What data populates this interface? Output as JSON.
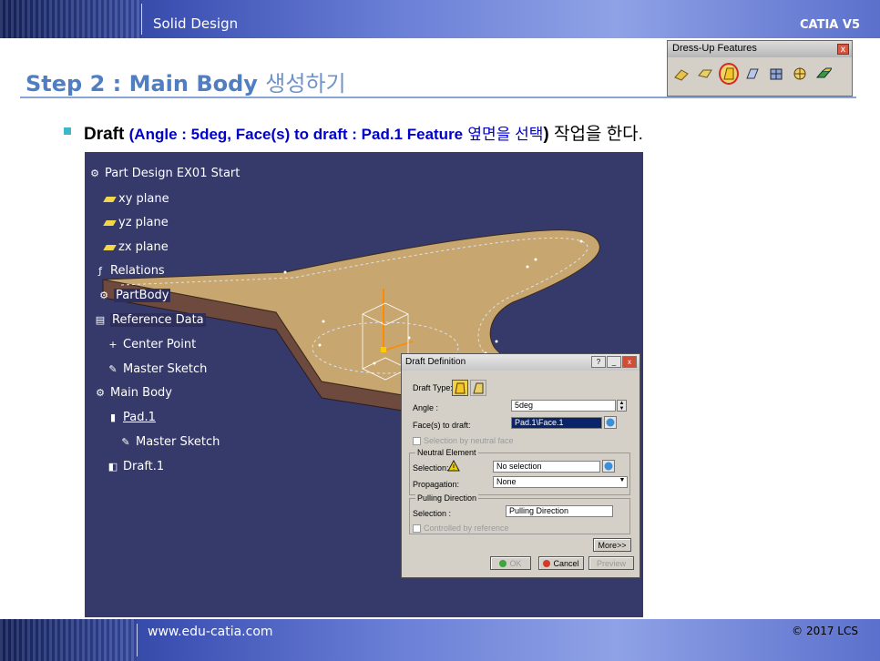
{
  "header": {
    "title": "Solid Design",
    "brand": "CATIA V5"
  },
  "step": {
    "title_en": "Step 2 : Main Body",
    "title_kr": "생성하기"
  },
  "toolbar": {
    "title": "Dress-Up Features",
    "close": "x",
    "tools": [
      {
        "icon": "fillet-icon"
      },
      {
        "icon": "chamfer-icon"
      },
      {
        "icon": "draft-icon",
        "active": true
      },
      {
        "icon": "shell-icon"
      },
      {
        "icon": "thickness-icon"
      },
      {
        "icon": "thread-icon"
      },
      {
        "icon": "remove-face-icon"
      }
    ]
  },
  "instruction": {
    "bold": "Draft",
    "open": "(",
    "params": "Angle : 5deg, Face(s) to draft : Pad.1 Feature",
    "params_kr": "옆면을 선택",
    "close": ")",
    "tail": "작업을 한다."
  },
  "tree": {
    "items": [
      {
        "label": "Part Design EX01 Start"
      },
      {
        "label": "xy plane"
      },
      {
        "label": "yz plane"
      },
      {
        "label": "zx plane"
      },
      {
        "label": "Relations"
      },
      {
        "label": "PartBody"
      },
      {
        "label": "Reference Data"
      },
      {
        "label": "Center Point"
      },
      {
        "label": "Master Sketch"
      },
      {
        "label": "Main Body"
      },
      {
        "label": "Pad.1"
      },
      {
        "label": "Master Sketch"
      },
      {
        "label": "Draft.1"
      }
    ]
  },
  "dialog": {
    "title": "Draft Definition",
    "title_buttons": {
      "help": "?",
      "min": "_",
      "close": "x"
    },
    "draft_type_label": "Draft Type:",
    "angle_label": "Angle :",
    "angle_value": "5deg",
    "faces_label": "Face(s) to draft:",
    "faces_value": "Pad.1\\Face.1",
    "selection_neutral_face": "Selection by neutral face",
    "neutral_group": "Neutral Element",
    "selection_label": "Selection:",
    "selection_value": "No selection",
    "propagation_label": "Propagation:",
    "propagation_value": "None",
    "pulling_group": "Pulling Direction",
    "pulling_selection_label": "Selection :",
    "pulling_selection_value": "Pulling Direction",
    "controlled_by_reference": "Controlled by reference",
    "more_button": "More>>",
    "ok_button": "OK",
    "cancel_button": "Cancel",
    "preview_button": "Preview"
  },
  "footer": {
    "url": "www.edu-catia.com",
    "copyright": "© 2017 LCS"
  },
  "colors": {
    "header_band": "#3e52b4",
    "title_blue": "#4f7ec3",
    "param_blue": "#0000cc",
    "viewport_bg": "#363a6a",
    "body_fill": "#c7a670",
    "side_fill": "#6e4a3e",
    "bullet": "#3db7c9"
  }
}
